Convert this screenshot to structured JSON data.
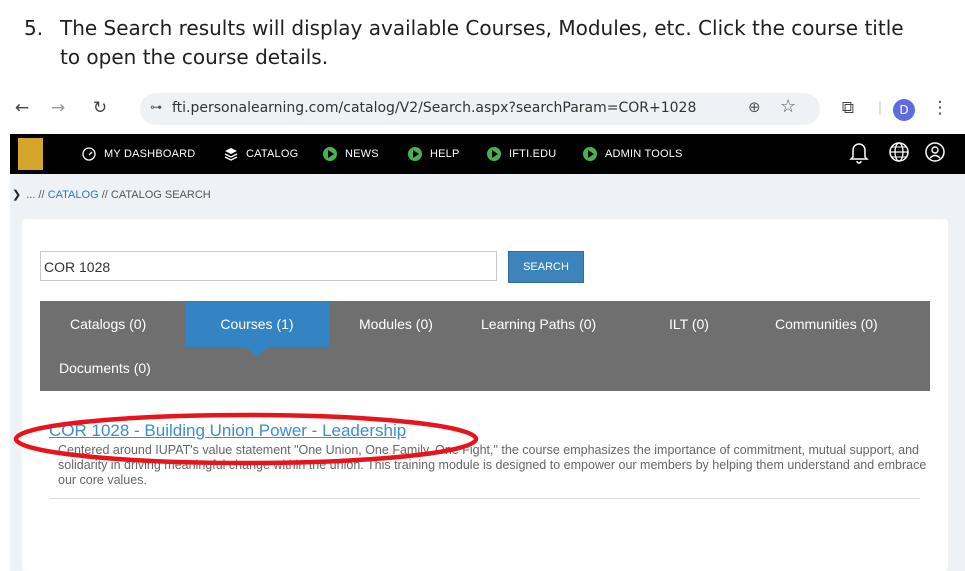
{
  "caption": {
    "number": "5.",
    "text": "The Search results will display available Courses, Modules, etc. Click the course title to open the course details."
  },
  "browser": {
    "back_icon": "arrow-left-icon",
    "forward_icon": "arrow-right-icon",
    "reload_icon": "reload-icon",
    "url": "fti.personalearning.com/catalog/V2/Search.aspx?searchParam=COR+1028",
    "profile_initial": "D"
  },
  "nav": {
    "items": [
      {
        "label": "MY DASHBOARD",
        "icon": "dashboard-gauge-icon"
      },
      {
        "label": "CATALOG",
        "icon": "layers-icon"
      },
      {
        "label": "NEWS",
        "icon": "play-circle-icon"
      },
      {
        "label": "HELP",
        "icon": "play-circle-icon"
      },
      {
        "label": "IFTI.EDU",
        "icon": "play-circle-icon"
      },
      {
        "label": "ADMIN TOOLS",
        "icon": "play-circle-icon"
      }
    ],
    "accent_color": "#4caf50"
  },
  "breadcrumb": {
    "ellipsis": "... //",
    "catalog_link": "CATALOG",
    "separator": "//",
    "current": "CATALOG SEARCH"
  },
  "search": {
    "value": "COR 1028",
    "button_label": "SEARCH"
  },
  "tabs": [
    {
      "label": "Catalogs (0)"
    },
    {
      "label": "Courses (1)"
    },
    {
      "label": "Modules (0)"
    },
    {
      "label": "Learning Paths (0)"
    },
    {
      "label": "ILT (0)"
    },
    {
      "label": "Communities (0)"
    },
    {
      "label": "Documents (0)"
    }
  ],
  "active_tab": "Courses (1)",
  "results": [
    {
      "title": "COR 1028 - Building Union Power - Leadership",
      "description": "Centered around IUPAT's value statement \"One Union, One Family, One Fight,\" the course emphasizes the importance of commitment, mutual support, and solidarity in driving meaningful change within the union. This training module is designed to empower our members by helping them understand and embrace our core values."
    }
  ],
  "colors": {
    "annotation_ellipse": "#e8141c",
    "active_tab": "#3484c3",
    "link": "#3c8ec9"
  }
}
